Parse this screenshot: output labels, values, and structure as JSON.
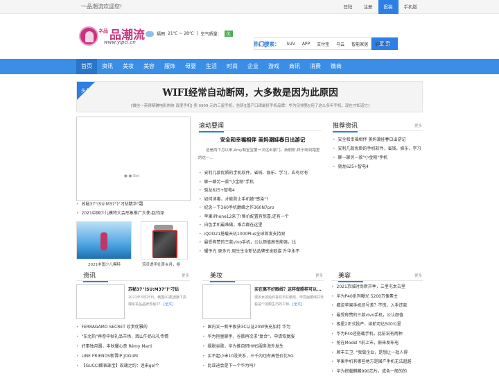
{
  "topbar": {
    "welcome": "一品潮流欢迎您!",
    "links": [
      "登陆",
      "注册",
      "投稿",
      "手机版"
    ],
    "active_index": 2
  },
  "logo": {
    "small": "ネ品",
    "text": "品潮流",
    "url": "www.yipcl.cn"
  },
  "weather": {
    "city": "福田",
    "temp": "21℃ ~ 28℃",
    "aq_label": "空气质量：",
    "aq_value": "优"
  },
  "search": {
    "placeholder": "",
    "button": "搜 索"
  },
  "hot": {
    "label": "热门搜索：",
    "items": [
      "SUV",
      "APP",
      "支付宝",
      "马云",
      "智能家居",
      "iphone"
    ]
  },
  "nav": {
    "items": [
      "首页",
      "资讯",
      "美妆",
      "美容",
      "服饰",
      "母婴",
      "生活",
      "时尚",
      "企业",
      "游戏",
      "商讯",
      "消费",
      "微商"
    ],
    "active_index": 0
  },
  "banner": {
    "tag": "头条",
    "title": "WIFI经常自动断网，大多数是因为此原因",
    "sub": "[微信一英镑精辅电影热映 百度手机] 卖 9999 元的三星手机，告辞][国产口碑最好手机品牌：华为仅排第][用了这么多年手机，现在才知道它]"
  },
  "slider": {
    "caption": "Bet"
  },
  "left_list": [
    "苏秘37°(SU:M37°)\"刁钻精华\"霜",
    "2021中国少儿模特大会形象推广大使-赵钧泽"
  ],
  "thumbs": {
    "t1_caption": "2021中国少儿模特",
    "t2_caption": "流灵透手壮首乡月，卷"
  },
  "news": {
    "title": "滚动要闻",
    "headline": "安全和幸福相伴 美妈潮娃春日出游记",
    "desc": "这是两个月以来,Amy和宝宝第一次远出家门。新舸附,终于盼到踏里的这一...",
    "items": [
      "安利几款优质的手机软件，省钱、娱乐、学习，应有尽有",
      "聊一聊另一款\"小金刚\"手机",
      "骁龙625+智电4",
      "如何消毒，才能防止手机被\"感染\"?",
      "纪念一下360手机巅峰之作360N7pro",
      "苹果iPhone12来了!售价配置有惊喜,还有一个",
      "白色手机最难做，难点都在这里",
      "iQOO21搭载天玑1000Plus全球首发支持双",
      "最受称赞的三款vivo手机，公认颜值高性能强，比",
      "耀予光 更多元 周生生全新钻品牌享发欧姿 升华永不"
    ]
  },
  "recommend": {
    "title": "推荐资讯",
    "more": "更多",
    "items": [
      "安全和幸福相伴 美妈潮娃春日出游记",
      "安利几款优质的手机软件，省钱、娱乐、学习",
      "聊一聊另一款\"小金刚\"手机",
      "骁龙625+智电4"
    ]
  },
  "zixun": {
    "title": "资讯",
    "more": "更多",
    "card_title": "苏秘37°(SU:M37°)\"刁钻",
    "card_desc": "2021年3月25日，韩国LG集团旗下高端化妆品品牌苏秘37...",
    "card_full": "[全文]",
    "items": [
      "FERRAGAMO SECRET 珍贵优雅的",
      "\"东北热\"再卷中秋礼品市场，辉山牛奶以礼传情",
      "好事独月圆，中秋耀心意 Rémy Marti",
      "LINE FRIENDS新晋IP JOGUM",
      "【GUCCI酸表珠宝】玫瑰之约：迷来gel个"
    ]
  },
  "meizhuang": {
    "title": "美妆",
    "more": "更多",
    "card_title": "买在高不好眼线？这样做照样可以...",
    "card_desc": "很多女孩始终喜欢不好眼线，毕竟画眼线并非看是个孩颇生巧的工种。",
    "card_full": "[全文]",
    "items": [
      "国内又一新平板获3C认证20W快充加持 华为",
      "华为抱量聊手，谷歌再次求\"复合\"，申请恢复服",
      "摆脱谷歌，华为推自研HMS服务海外发生",
      "买不起小米10没关系，三千内也有高性价比5G",
      "比亚迪会是下一个华为吗?"
    ]
  },
  "meirong": {
    "title": "美容",
    "more": "更多",
    "items": [
      "2021京城时尚新开季，三里屯太古里",
      "华为P40系列曝光 5200万像素主",
      "都说苹果手机信号差？不慌，入手还款",
      "最受称赞的三款vivo手机，公认颜值",
      "极星2正式投产，续航可达500公里",
      "华为P40还搭载手机，此前说有两种",
      "抢在Model Y前上市，蔚来发布电",
      "顺丰王卫: \"我做企业，是想让一批人得",
      "苹果手机有哪些地方是国产手机无法超越",
      "华为搭载麒麟990芯片，成色一般的的"
    ]
  }
}
